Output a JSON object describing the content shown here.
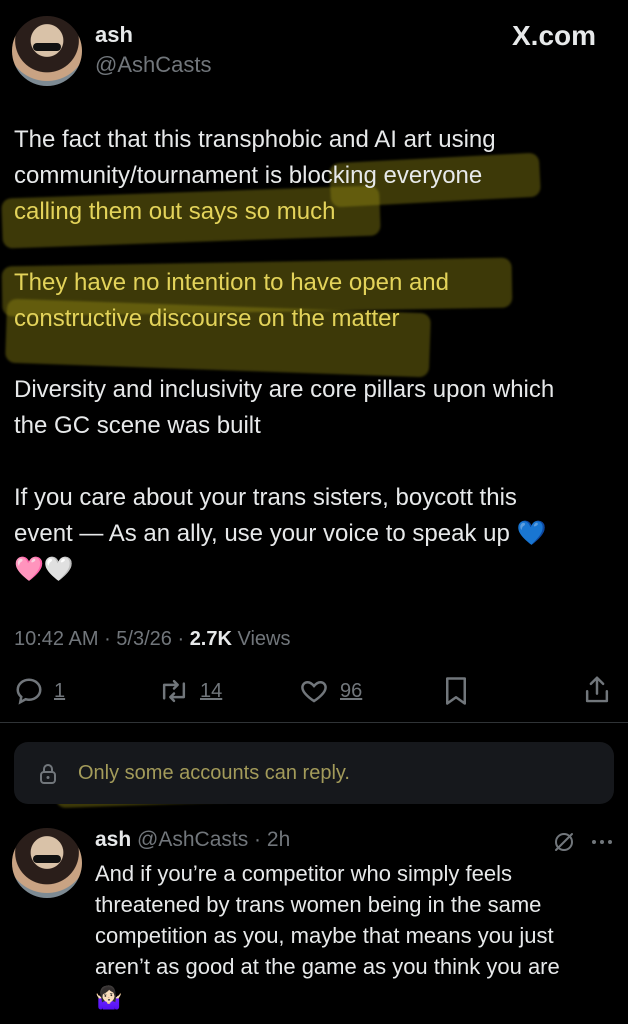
{
  "brand": {
    "logo_text": "X.com"
  },
  "tweet": {
    "author_name": "ash",
    "author_handle": "@AshCasts",
    "paragraphs": [
      "The fact that this transphobic and AI art using community/tournament is blocking everyone calling them out says so much",
      "They have no intention to have open and constructive discourse on the matter",
      "Diversity and inclusivity are core pillars upon which the GC scene was built",
      "If you care about your trans sisters, boycott this event — As an ally, use your voice to speak up 💙 🩷🤍"
    ],
    "lines": {
      "p1_l1_a": "The fact that this transphobic and AI art using",
      "p1_l2_a": "community/tournament is b",
      "p1_l2_b": "locking everyone",
      "p1_l3": "calling them out says so much",
      "p2_l1": "They have no intention to have open and",
      "p2_l2": "constructive discourse on the matter",
      "p3_l1": "Diversity and inclusivity are core pillars upon which",
      "p3_l2": "the GC scene was built",
      "p4_l1": "If you care about your trans sisters, boycott this",
      "p4_l2": "event — As an ally, use your voice to speak up 💙",
      "p4_l3": "🩷🤍"
    },
    "time": "10:42 AM",
    "date": "5/3/26",
    "views_count": "2.7K",
    "views_label": "Views",
    "replies": "1",
    "reposts": "14",
    "likes": "96",
    "accent_colors": {
      "highlight": "#e3d35a",
      "muted": "#71767b"
    }
  },
  "reply_restriction": {
    "text": "Only some accounts can reply."
  },
  "reply": {
    "author_name": "ash",
    "author_handle": "@AshCasts",
    "age": "2h",
    "lines": [
      "And if you’re a competitor who simply feels",
      "threatened by trans women being in the same",
      "competition as you, maybe that means you just",
      "aren’t as good at the game as you think you are",
      "🤷🏻‍♀️"
    ]
  },
  "icons": [
    "reply-icon",
    "repost-icon",
    "like-icon",
    "bookmark-icon",
    "share-icon",
    "lock-icon",
    "grok-icon",
    "more-icon"
  ]
}
